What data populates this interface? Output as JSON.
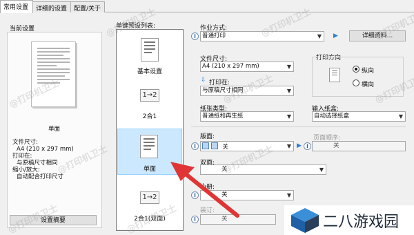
{
  "tabs": [
    {
      "label": "常用设置",
      "active": true
    },
    {
      "label": "详细的设置",
      "active": false
    },
    {
      "label": "配置/关于",
      "active": false
    }
  ],
  "current_settings": {
    "title": "当前设置",
    "mode": "单面",
    "lines": [
      "文件尺寸:",
      "A4 (210 x 297 mm)",
      "打印在:",
      "与原稿尺寸相同",
      "缩小/放大:",
      "自动配合打印尺寸"
    ],
    "summary_button": "设置摘要"
  },
  "preset_list": {
    "label": "单键预设列表:",
    "items": [
      {
        "label": "基本设置",
        "icon": "single-page-icon"
      },
      {
        "label": "2合1",
        "icon": "two-in-one-icon",
        "icon_text": "1→2"
      },
      {
        "label": "单面",
        "icon": "single-page-icon",
        "selected": true
      },
      {
        "label": "2合1(双面)",
        "icon": "two-in-one-duplex-icon",
        "icon_text": "1→2"
      }
    ]
  },
  "job_type": {
    "label": "作业方式:",
    "value": "普通打印",
    "details_button": "详细资料..."
  },
  "paper_size": {
    "label": "文件尺寸:",
    "value": "A4 (210 x 297 mm)"
  },
  "print_on": {
    "label": "打印在:",
    "value": "与原稿尺寸相同"
  },
  "orientation": {
    "label": "打印方向",
    "options": [
      "纵向",
      "横向"
    ],
    "selected": "纵向"
  },
  "paper_type": {
    "label": "纸张类型:",
    "value": "普通纸和再生纸"
  },
  "paper_source": {
    "label": "输入纸盒:",
    "value": "自动选择纸盒"
  },
  "layout": {
    "label": "版面:",
    "value": "关"
  },
  "page_order": {
    "label": "页面顺序:",
    "value": "关"
  },
  "duplex": {
    "label": "双面:",
    "value": "关"
  },
  "booklet": {
    "label": "小册:",
    "value": "关"
  },
  "binding": {
    "label": "装订:",
    "value": "关"
  },
  "watermark_text": "@打印机卫士",
  "logo_text": "二八游戏园",
  "colors": {
    "selected_bg": "#cce8ff",
    "accent": "#2d7fd1",
    "arrow": "#e03535",
    "logo_blue": "#2f7fc8"
  }
}
